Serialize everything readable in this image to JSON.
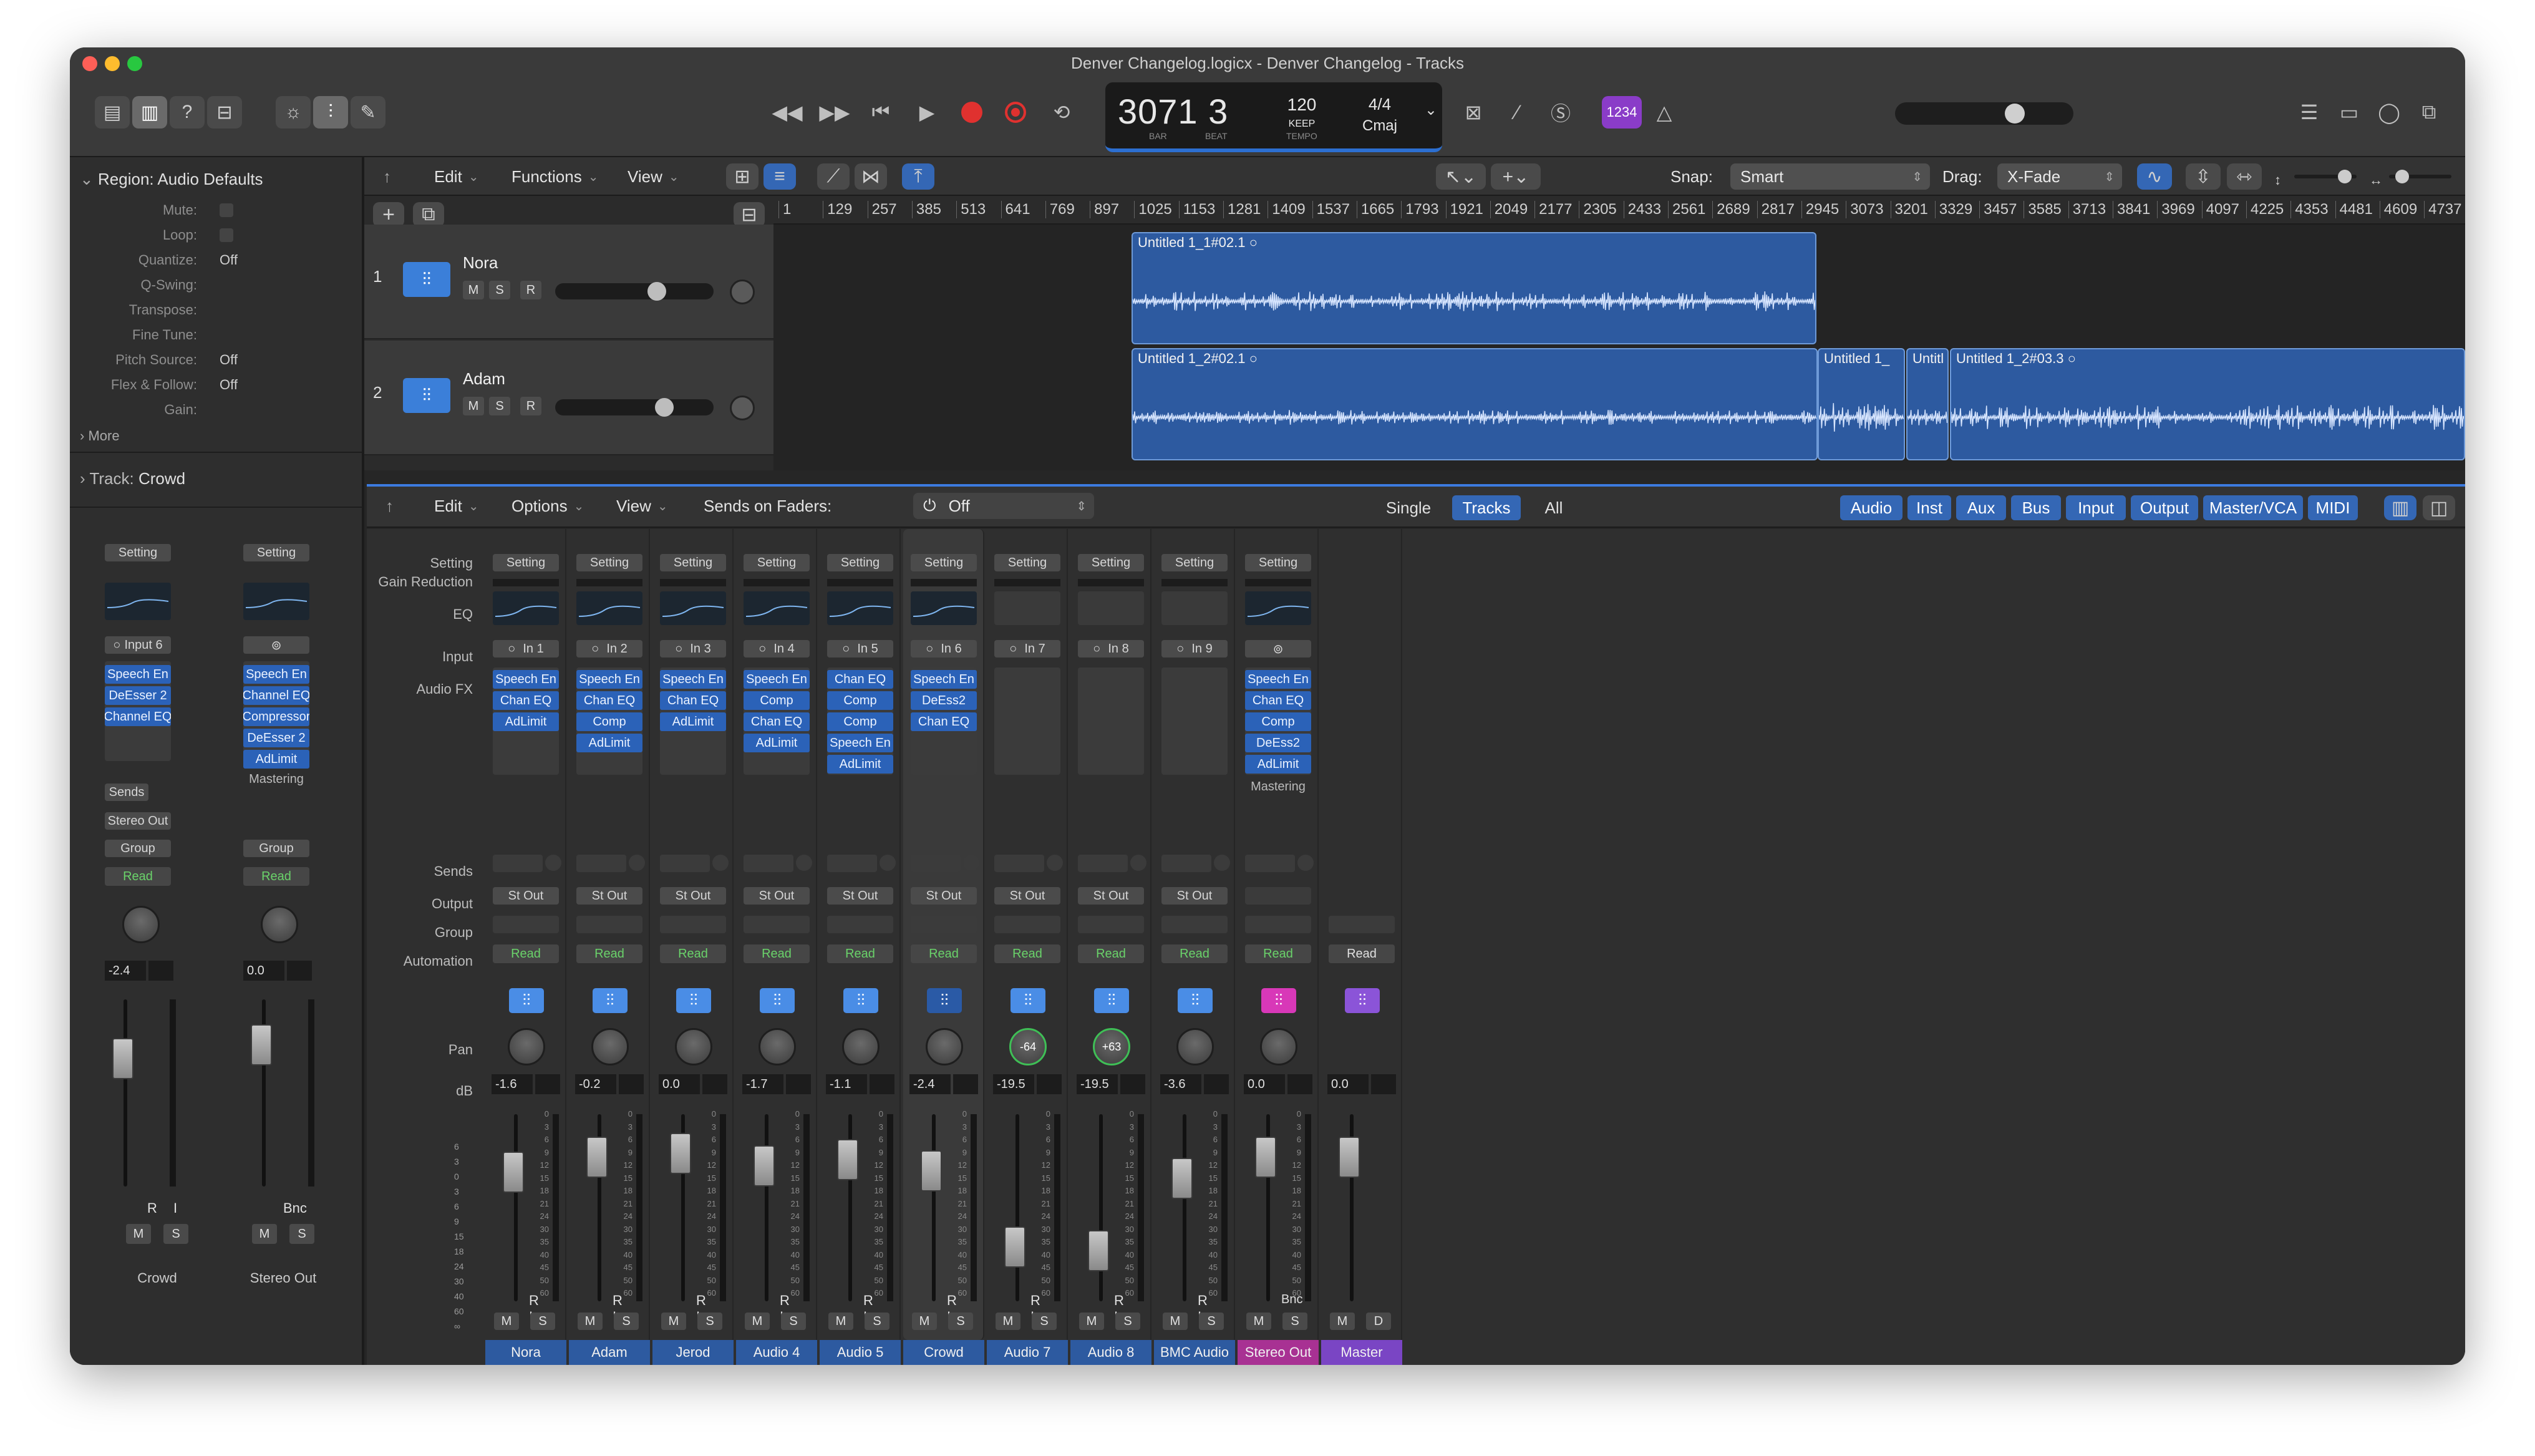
{
  "window": {
    "title": "Denver Changelog.logicx - Denver Changelog - Tracks"
  },
  "lcd": {
    "position": "3071 3",
    "bar_label": "BAR",
    "beat_label": "BEAT",
    "tempo": "120",
    "keep_label": "KEEP",
    "tempo_label": "TEMPO",
    "signature": "4/4",
    "key": "Cmaj"
  },
  "badge": "1234",
  "inspector": {
    "region_header": "Region: Audio Defaults",
    "rows": [
      {
        "k": "Mute:",
        "v": ""
      },
      {
        "k": "Loop:",
        "v": ""
      },
      {
        "k": "Quantize:",
        "v": "Off"
      },
      {
        "k": "Q-Swing:",
        "v": ""
      },
      {
        "k": "Transpose:",
        "v": ""
      },
      {
        "k": "Fine Tune:",
        "v": ""
      },
      {
        "k": "Pitch Source:",
        "v": "Off"
      },
      {
        "k": "Flex & Follow:",
        "v": "Off"
      },
      {
        "k": "Gain:",
        "v": ""
      }
    ],
    "more": "More",
    "track_header_label": "Track:",
    "track_header_value": "Crowd",
    "strip1": {
      "setting": "Setting",
      "input": "Input 6",
      "fx": [
        "Speech En",
        "DeEsser 2",
        "Channel EQ"
      ],
      "sends": "Sends",
      "output": "Stereo Out",
      "group": "Group",
      "auto": "Read",
      "db": "-2.4",
      "ri": "R I",
      "m": "M",
      "s": "S",
      "name": "Crowd"
    },
    "strip2": {
      "setting": "Setting",
      "fx": [
        "Speech En",
        "Channel EQ",
        "Compressor",
        "DeEsser 2",
        "AdLimit"
      ],
      "mastering": "Mastering",
      "group": "Group",
      "auto": "Read",
      "db": "0.0",
      "bnc": "Bnc",
      "m": "M",
      "s": "S",
      "name": "Stereo Out"
    }
  },
  "tracks_bar": {
    "edit": "Edit",
    "functions": "Functions",
    "view": "View",
    "snap_label": "Snap:",
    "snap_value": "Smart",
    "drag_label": "Drag:",
    "drag_value": "X-Fade"
  },
  "ruler": [
    "1",
    "129",
    "257",
    "385",
    "513",
    "641",
    "769",
    "897",
    "1025",
    "1153",
    "1281",
    "1409",
    "1537",
    "1665",
    "1793",
    "1921",
    "2049",
    "2177",
    "2305",
    "2433",
    "2561",
    "2689",
    "2817",
    "2945",
    "3073",
    "3201",
    "3329",
    "3457",
    "3585",
    "3713",
    "3841",
    "3969",
    "4097",
    "4225",
    "4353",
    "4481",
    "4609",
    "4737",
    "4"
  ],
  "tracks": [
    {
      "num": "1",
      "name": "Nora",
      "m": "M",
      "s": "S",
      "r": "R"
    },
    {
      "num": "2",
      "name": "Adam",
      "m": "M",
      "s": "S",
      "r": "R"
    }
  ],
  "regions": {
    "r1": "Untitled 1_1#02.1",
    "r2": "Untitled 1_2#02.1",
    "r3": "Untitled 1_",
    "r4": "Untitl",
    "r5": "Untitled 1_2#03.3"
  },
  "mixer_bar": {
    "edit": "Edit",
    "options": "Options",
    "view": "View",
    "sends_on_faders": "Sends on Faders:",
    "sends_value": "Off",
    "modes": [
      "Single",
      "Tracks",
      "All"
    ],
    "filters": [
      "Audio",
      "Inst",
      "Aux",
      "Bus",
      "Input",
      "Output",
      "Master/VCA",
      "MIDI"
    ]
  },
  "mixer_labels": {
    "setting": "Setting",
    "gain_reduction": "Gain Reduction",
    "eq": "EQ",
    "input": "Input",
    "audio_fx": "Audio FX",
    "sends": "Sends",
    "output": "Output",
    "group": "Group",
    "automation": "Automation",
    "pan": "Pan",
    "db": "dB"
  },
  "fader_scale": [
    "0",
    "3",
    "6",
    "9",
    "12",
    "15",
    "18",
    "21",
    "24",
    "30",
    "35",
    "40",
    "45",
    "50",
    "60"
  ],
  "strips": [
    {
      "name": "Nora",
      "setting": "Setting",
      "input": "In 1",
      "fx": [
        "Speech En",
        "Chan EQ",
        "AdLimit"
      ],
      "output": "St Out",
      "auto": "Read",
      "pan": "",
      "db": "-1.6",
      "ri": "R I",
      "m": "M",
      "s": "S"
    },
    {
      "name": "Adam",
      "setting": "Setting",
      "input": "In 2",
      "fx": [
        "Speech En",
        "Chan EQ",
        "Comp",
        "AdLimit"
      ],
      "output": "St Out",
      "auto": "Read",
      "pan": "",
      "db": "-0.2",
      "ri": "R I",
      "m": "M",
      "s": "S"
    },
    {
      "name": "Jerod",
      "setting": "Setting",
      "input": "In 3",
      "fx": [
        "Speech En",
        "Chan EQ",
        "AdLimit"
      ],
      "output": "St Out",
      "auto": "Read",
      "pan": "",
      "db": "0.0",
      "ri": "R I",
      "m": "M",
      "s": "S"
    },
    {
      "name": "Audio 4",
      "setting": "Setting",
      "input": "In 4",
      "fx": [
        "Speech En",
        "Comp",
        "Chan EQ",
        "AdLimit"
      ],
      "output": "St Out",
      "auto": "Read",
      "pan": "",
      "db": "-1.7",
      "ri": "R I",
      "m": "M",
      "s": "S"
    },
    {
      "name": "Audio 5",
      "setting": "Setting",
      "input": "In 5",
      "fx": [
        "Chan EQ",
        "Comp",
        "Comp",
        "Speech En",
        "AdLimit"
      ],
      "output": "St Out",
      "auto": "Read",
      "pan": "",
      "db": "-1.1",
      "ri": "R I",
      "m": "M",
      "s": "S"
    },
    {
      "name": "Crowd",
      "setting": "Setting",
      "input": "In 6",
      "fx": [
        "Speech En",
        "DeEss2",
        "Chan EQ"
      ],
      "output": "St Out",
      "auto": "Read",
      "pan": "",
      "db": "-2.4",
      "ri": "R I",
      "m": "M",
      "s": "S"
    },
    {
      "name": "Audio 7",
      "setting": "Setting",
      "input": "In 7",
      "fx": [],
      "output": "St Out",
      "auto": "Read",
      "pan": "-64",
      "db": "-19.5",
      "ri": "R I",
      "m": "M",
      "s": "S"
    },
    {
      "name": "Audio 8",
      "setting": "Setting",
      "input": "In 8",
      "fx": [],
      "output": "St Out",
      "auto": "Read",
      "pan": "+63",
      "db": "-19.5",
      "ri": "R I",
      "m": "M",
      "s": "S"
    },
    {
      "name": "BMC Audio",
      "setting": "Setting",
      "input": "In 9",
      "fx": [],
      "output": "St Out",
      "auto": "Read",
      "pan": "",
      "db": "-3.6",
      "ri": "R I",
      "m": "M",
      "s": "S"
    },
    {
      "name": "Stereo Out",
      "setting": "Setting",
      "input": "",
      "fx": [
        "Speech En",
        "Chan EQ",
        "Comp",
        "DeEss2",
        "AdLimit"
      ],
      "mastering": "Mastering",
      "output": "",
      "auto": "Read",
      "pan": "",
      "db": "0.0",
      "ri": "Bnc",
      "m": "M",
      "s": "S"
    },
    {
      "name": "Master",
      "setting": "",
      "input": "",
      "fx": [],
      "output": "",
      "auto": "Read",
      "pan": "",
      "db": "0.0",
      "ri": "",
      "m": "M",
      "s": "D"
    }
  ],
  "colors": {
    "accent": "#3467b5",
    "region": "#2d5aa0",
    "stereo_out": "#a83193",
    "master": "#7a45c4",
    "read": "#6ad36a"
  }
}
